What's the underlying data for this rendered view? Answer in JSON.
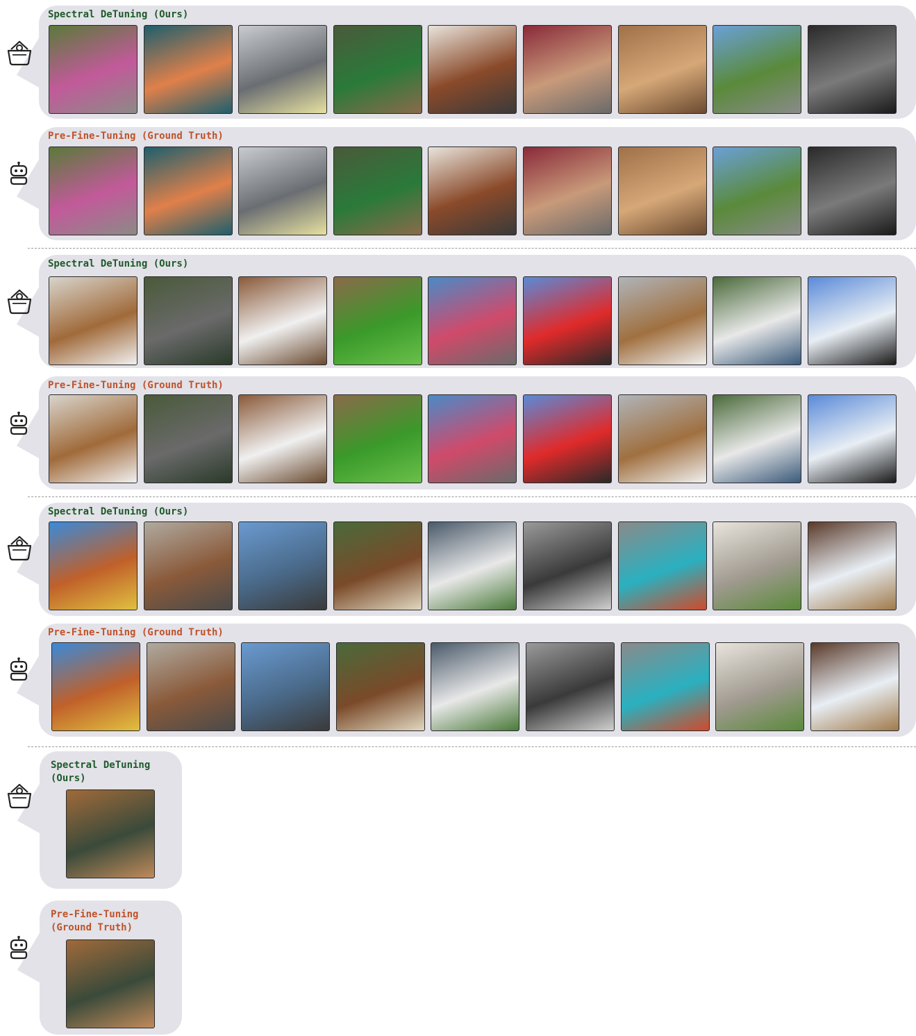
{
  "label_ours": "Spectral DeTuning (Ours)",
  "label_gt": "Pre-Fine-Tuning (Ground Truth)",
  "label_ours_wrapped": "Spectral DeTuning\n(Ours)",
  "label_gt_wrapped": "Pre-Fine-Tuning\n(Ground Truth)",
  "icons": {
    "ours": "robot-with-basket-hat-icon",
    "gt": "robot-icon"
  },
  "colors": {
    "ours_label": "#1f5a2a",
    "gt_label": "#c0522a",
    "panel": "#e2e2e8"
  },
  "groups": [
    {
      "images": [
        [
          "#5a7a3a",
          "#c25a9a",
          "#8c8a86"
        ],
        [
          "#1e5f6e",
          "#e0804a",
          "#1e5f6e"
        ],
        [
          "#c8ccd0",
          "#6a6e72",
          "#e6e0a0"
        ],
        [
          "#4a5a3a",
          "#2a7a3a",
          "#8a6a4a"
        ],
        [
          "#e8e4dc",
          "#8a4a2a",
          "#3a3a3a"
        ],
        [
          "#8a2a3a",
          "#c89a7a",
          "#6a6a6a"
        ],
        [
          "#a07048",
          "#d6a878",
          "#6a4a30"
        ],
        [
          "#6aa0d8",
          "#5a8a3a",
          "#8a8a8a"
        ],
        [
          "#2a2a2a",
          "#7a7a7a",
          "#1a1a1a"
        ]
      ]
    },
    {
      "images": [
        [
          "#d8d4cc",
          "#a06a3a",
          "#f0f0f0"
        ],
        [
          "#4a5a3a",
          "#6a6a6a",
          "#2a3a2a"
        ],
        [
          "#8a5a3a",
          "#f0f0f0",
          "#6a4a30"
        ],
        [
          "#8a6a4a",
          "#3a9a2a",
          "#6ac04a"
        ],
        [
          "#4a8ac8",
          "#d04a6a",
          "#6a6a6a"
        ],
        [
          "#5a8ad8",
          "#e02a2a",
          "#2a2a2a"
        ],
        [
          "#b0b4b8",
          "#a07040",
          "#f0f0f0"
        ],
        [
          "#4a6a3a",
          "#e8e8e8",
          "#3a5a7a"
        ],
        [
          "#5a8ad8",
          "#e8eef4",
          "#1a1a1a"
        ]
      ]
    },
    {
      "images": [
        [
          "#3a8ad8",
          "#c0602a",
          "#e0c040"
        ],
        [
          "#b0aaa0",
          "#8a5a3a",
          "#4a4a4a"
        ],
        [
          "#6a9ad0",
          "#4a6a8a",
          "#3a3a3a"
        ],
        [
          "#4a6a3a",
          "#7a4a2a",
          "#e0d8c0"
        ],
        [
          "#4a5a6a",
          "#e8e8e8",
          "#4a7a3a"
        ],
        [
          "#9a9a9a",
          "#3a3a3a",
          "#d0d0d0"
        ],
        [
          "#8a8a8a",
          "#2ab0c0",
          "#d04a2a"
        ],
        [
          "#e8e4dc",
          "#a09a90",
          "#5a8a3a"
        ],
        [
          "#5a3a2a",
          "#e8eef4",
          "#a07a4a"
        ]
      ]
    },
    {
      "images": [
        [
          "#a06a3a",
          "#3a4a3a",
          "#c08a5a"
        ]
      ]
    }
  ]
}
